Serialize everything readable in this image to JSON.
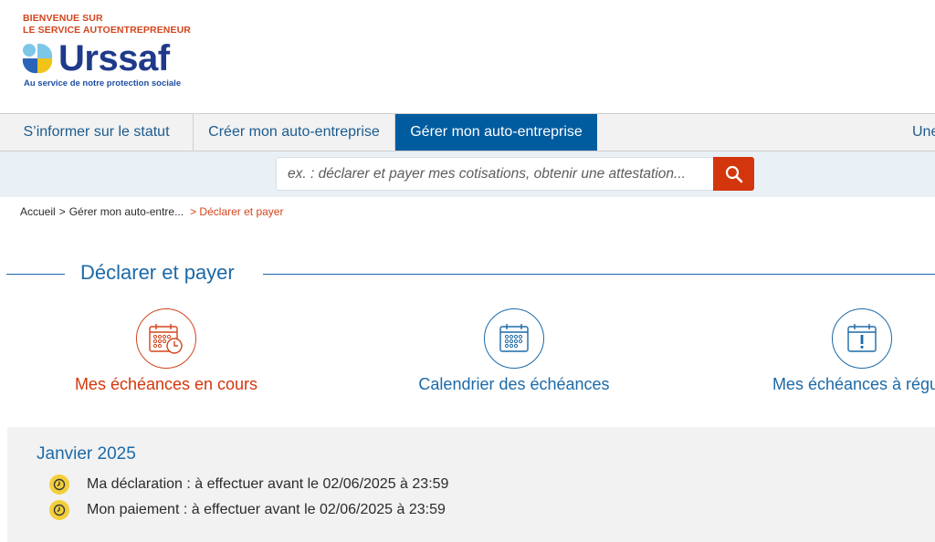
{
  "header": {
    "welcome_line1": "BIENVENUE SUR",
    "welcome_line2": "LE SERVICE AUTOENTREPRENEUR",
    "logo_text": "Urssaf",
    "tagline": "Au service de notre protection sociale"
  },
  "nav": {
    "items": [
      {
        "label": "S’informer sur le statut",
        "active": false
      },
      {
        "label": "Créer mon auto-entreprise",
        "active": false
      },
      {
        "label": "Gérer mon auto-entreprise",
        "active": true
      },
      {
        "label": "Une",
        "active": false
      }
    ]
  },
  "search": {
    "placeholder": "ex. : déclarer et payer mes cotisations, obtenir une attestation...",
    "icon": "search-icon"
  },
  "breadcrumb": {
    "home": "Accueil",
    "sep1": ">",
    "parent": "Gérer mon auto-entre...",
    "current": "> Déclarer et payer"
  },
  "section": {
    "title": "Déclarer et payer"
  },
  "tiles": [
    {
      "label": "Mes échéances en cours",
      "icon": "calendar-clock-icon",
      "color": "#d3360c"
    },
    {
      "label": "Calendrier des échéances",
      "icon": "calendar-icon",
      "color": "#1c6aa8"
    },
    {
      "label": "Mes échéances à régula",
      "icon": "calendar-alert-icon",
      "color": "#1c6aa8"
    }
  ],
  "panel": {
    "title": "Janvier 2025",
    "deadlines": [
      {
        "text": "Ma déclaration : à effectuer avant le 02/06/2025 à 23:59",
        "icon": "clock-icon"
      },
      {
        "text": "Mon paiement : à effectuer avant le 02/06/2025 à 23:59",
        "icon": "clock-icon"
      }
    ]
  },
  "colors": {
    "brand_blue": "#005b9f",
    "link_blue": "#1c6aa8",
    "accent_red": "#d3360c",
    "clock_yellow": "#f3cf3b"
  }
}
